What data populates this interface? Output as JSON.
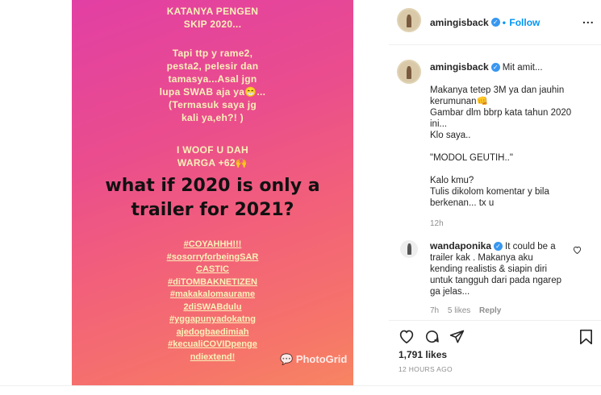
{
  "story": {
    "lines_top": [
      "KATANYA PENGEN",
      "SKIP 2020..."
    ],
    "lines_mid": [
      "Tapi ttp y rame2,",
      "pesta2, pelesir dan",
      "tamasya...Asal jgn",
      "lupa SWAB aja ya😁...",
      "(Termasuk saya jg",
      "kali ya,eh?! )"
    ],
    "lines_woof": [
      "I WOOF U DAH",
      "WARGA +62🙌"
    ],
    "headline": [
      "what if 2020 is only a",
      "trailer for 2021?"
    ],
    "hashtags": [
      "#COYAHHH!!!",
      "#sosorryforbeingSAR",
      "CASTIC",
      "#diTOMBAKNETIZEN",
      "#makakalomaurame",
      "2diSWABdulu",
      "#yggapunyadokatng",
      "ajedogbaedimiah",
      "#kecualiCOVIDpenge",
      "ndiextend!"
    ],
    "watermark": "PhotoGrid"
  },
  "header": {
    "username": "amingisback",
    "follow_separator": "•",
    "follow_label": "Follow",
    "more_glyph": "..."
  },
  "caption": {
    "username": "amingisback",
    "first_line": "Mit amit...",
    "lines": [
      "Makanya tetep 3M ya dan jauhin",
      "kerumunan👊",
      "Gambar dlm bbrp kata tahun 2020",
      "ini...",
      "Klo saya..",
      "",
      "\"MODOL GEUTIH..\"",
      "",
      "Kalo kmu?",
      "Tulis dikolom komentar y bila",
      "berkenan... tx u"
    ],
    "time": "12h"
  },
  "comment": {
    "username": "wandaponika",
    "first_line": "It could be a",
    "lines": [
      "trailer kak . Makanya aku",
      "kending realistis & siapin diri",
      "untuk tangguh dari pada ngarep",
      "ga jelas..."
    ],
    "time": "7h",
    "likes": "5 likes",
    "reply": "Reply"
  },
  "footer": {
    "likes": "1,791 likes",
    "timestamp": "12 HOURS AGO"
  },
  "colors": {
    "accent": "#0095f6",
    "verified": "#3897f0",
    "story_text": "#f8f2b8"
  }
}
